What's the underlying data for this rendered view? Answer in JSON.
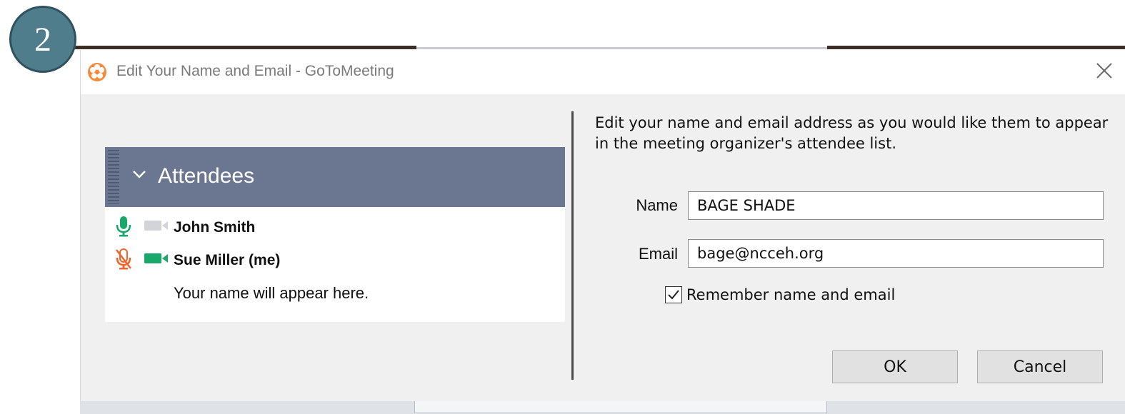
{
  "step": {
    "number": "2"
  },
  "window": {
    "title": "Edit Your Name and Email - GoToMeeting",
    "app_icon": "gotomeeting-flower-icon",
    "close_icon": "close-icon"
  },
  "attendees": {
    "header": "Attendees",
    "rows": [
      {
        "name": "John Smith",
        "mic": "mic-on",
        "camera": "camera-off"
      },
      {
        "name": "Sue Miller (me)",
        "mic": "mic-muted",
        "camera": "camera-on"
      }
    ],
    "placeholder": "Your name will appear here."
  },
  "form": {
    "instructions": "Edit your name and email address as you would like them to appear in the meeting organizer's attendee list.",
    "name_label": "Name",
    "name_value": "BAGE SHADE",
    "email_label": "Email",
    "email_value": "bage@ncceh.org",
    "remember_label": "Remember name and email",
    "remember_checked": true
  },
  "buttons": {
    "ok": "OK",
    "cancel": "Cancel"
  },
  "colors": {
    "header_bg": "#6b7790",
    "mic_on": "#1aa86a",
    "mic_muted": "#f0642a",
    "camera_on": "#1aa86a",
    "camera_off": "#d2d4d8",
    "badge": "#4f7d8c"
  }
}
